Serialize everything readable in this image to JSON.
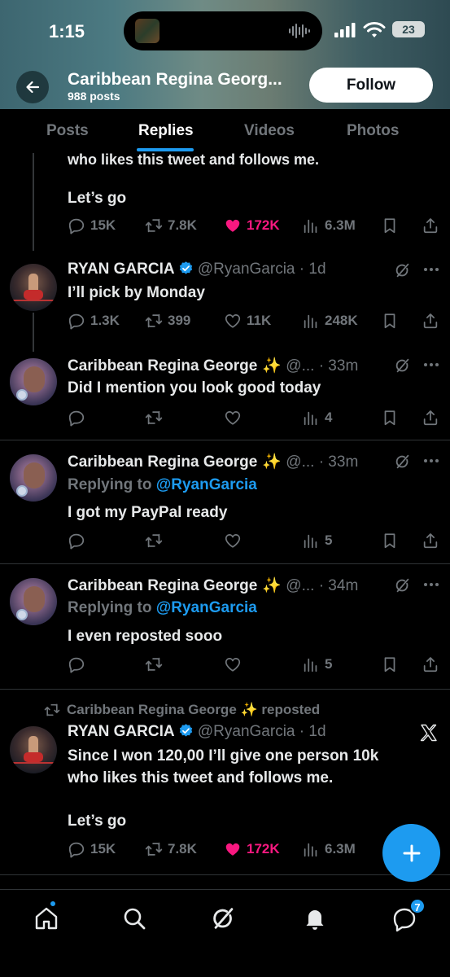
{
  "status_bar": {
    "time": "1:15",
    "battery": "23"
  },
  "header": {
    "profile_name": "Caribbean Regina Georg...",
    "post_count": "988 posts",
    "follow_label": "Follow"
  },
  "tabs": [
    {
      "label": "Posts",
      "active": false
    },
    {
      "label": "Replies",
      "active": true
    },
    {
      "label": "Videos",
      "active": false
    },
    {
      "label": "Photos",
      "active": false
    }
  ],
  "feed": {
    "cut_text": "who likes this tweet and follows me.",
    "tweet0": {
      "text": "Let’s go",
      "replies": "15K",
      "reposts": "7.8K",
      "likes": "172K",
      "views": "6.3M"
    },
    "tweet1": {
      "name": "RYAN GARCIA",
      "handle": "@RyanGarcia · 1d",
      "text": "I’ll pick by Monday",
      "replies": "1.3K",
      "reposts": "399",
      "likes": "11K",
      "views": "248K"
    },
    "tweet2": {
      "name": "Caribbean Regina George",
      "sparkle": "✨",
      "handle": "@... · 33m",
      "text": "Did I mention you look good today",
      "views": "4"
    },
    "tweet3": {
      "name": "Caribbean Regina George",
      "sparkle": "✨",
      "handle": "@... · 33m",
      "replying_prefix": "Replying to",
      "replying_to": "@RyanGarcia",
      "text": "I got my PayPal ready",
      "views": "5"
    },
    "tweet4": {
      "name": "Caribbean Regina George",
      "sparkle": "✨",
      "handle": "@... · 34m",
      "replying_prefix": "Replying to",
      "replying_to": "@RyanGarcia",
      "text": "I even reposted sooo",
      "views": "5"
    },
    "tweet5": {
      "repost_by": "Caribbean Regina George ✨ reposted",
      "name": "RYAN GARCIA",
      "handle": "@RyanGarcia · 1d",
      "text_line1": "Since I won 120,00 I’ll give one person 10k",
      "text_line2": "who likes this tweet and follows me.",
      "text_line3": "Let’s go",
      "replies": "15K",
      "reposts": "7.8K",
      "likes": "172K",
      "views": "6.3M"
    }
  },
  "bottom_nav": {
    "messages_badge": "7"
  },
  "colors": {
    "accent": "#1d9bf0",
    "like": "#f91880",
    "muted": "#71767b",
    "background": "#000000"
  },
  "icons": [
    "back-arrow-icon",
    "reply-icon",
    "repost-icon",
    "heart-icon",
    "views-icon",
    "bookmark-icon",
    "share-icon",
    "grok-icon",
    "more-icon",
    "verified-icon",
    "x-logo-icon",
    "compose-icon",
    "home-icon",
    "search-icon",
    "communities-icon",
    "notifications-icon",
    "messages-icon"
  ]
}
